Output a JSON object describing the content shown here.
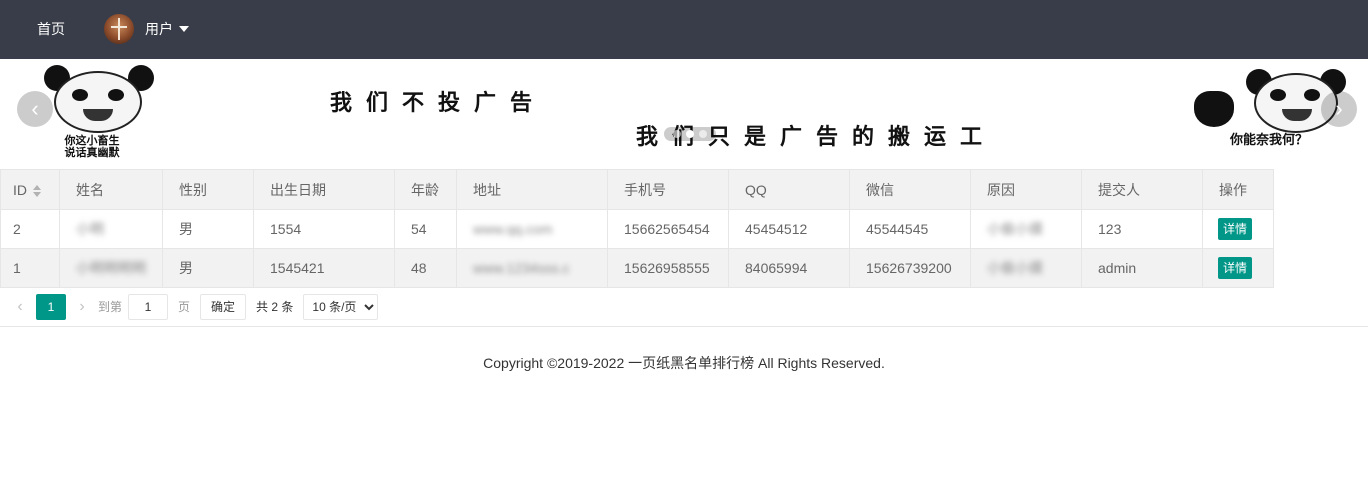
{
  "nav": {
    "home_label": "首页",
    "user_label": "用户"
  },
  "banner": {
    "left_caption_line1": "你这小畜生",
    "left_caption_line2": "说话真幽默",
    "text_line1": "我们不投广告",
    "text_line2": "我们只是广告的搬运工",
    "right_caption": "你能奈我何？",
    "prev_arrow": "‹",
    "next_arrow": "›"
  },
  "table": {
    "headers": [
      "ID",
      "姓名",
      "性别",
      "出生日期",
      "年龄",
      "地址",
      "手机号",
      "QQ",
      "微信",
      "原因",
      "提交人",
      "操作"
    ],
    "rows": [
      {
        "id": "2",
        "name": "小明",
        "gender": "男",
        "birth": "1554",
        "age": "54",
        "address": "www.qq.com",
        "phone": "15662565454",
        "qq": "45454512",
        "wechat": "45544545",
        "reason": "小偷小摸",
        "submitter": "123",
        "action": "详情"
      },
      {
        "id": "1",
        "name": "小明明明明",
        "gender": "男",
        "birth": "1545421",
        "age": "48",
        "address": "www.1234sss.c",
        "phone": "15626958555",
        "qq": "84065994",
        "wechat": "15626739200",
        "reason": "小偷小摸",
        "submitter": "admin",
        "action": "详情"
      }
    ]
  },
  "pager": {
    "current_page": "1",
    "goto_label": "到第",
    "page_unit": "页",
    "page_input_value": "1",
    "confirm_label": "确定",
    "total_label": "共 2 条",
    "page_size_selected": "10 条/页"
  },
  "footer": {
    "copyright": "Copyright ©2019-2022 一页纸黑名单排行榜 All Rights Reserved."
  },
  "colors": {
    "header_bg": "#393d49",
    "accent": "#009688",
    "table_header_bg": "#f2f2f2"
  }
}
